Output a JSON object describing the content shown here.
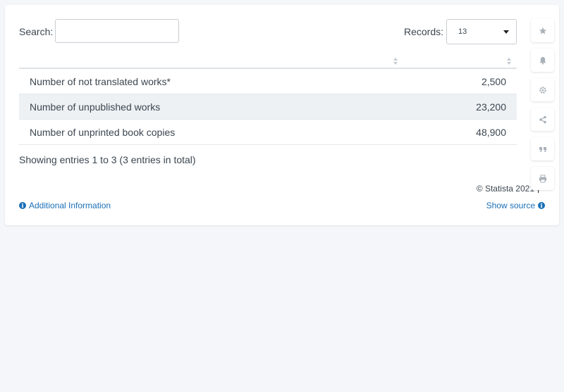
{
  "toolbar": {
    "search_label": "Search:",
    "search_value": "",
    "records_label": "Records:",
    "records_value": "13"
  },
  "chart_data": {
    "type": "table",
    "columns": [
      "",
      ""
    ],
    "rows": [
      {
        "label": "Number of not translated works*",
        "value": "2,500"
      },
      {
        "label": "Number of unpublished works",
        "value": "23,200"
      },
      {
        "label": "Number of unprinted book copies",
        "value": "48,900"
      }
    ]
  },
  "footer": {
    "showing": "Showing entries 1 to 3 (3 entries in total)",
    "copyright": "© Statista 2021",
    "additional_info": "Additional Information",
    "show_source": "Show source"
  },
  "sidebar": {
    "icons": [
      "star-icon",
      "bell-icon",
      "gear-icon",
      "share-icon",
      "quote-icon",
      "print-icon"
    ]
  },
  "colors": {
    "link": "#1a6fb6",
    "row_alt": "#eef1f4",
    "icon_gray": "#a9b1b9"
  }
}
